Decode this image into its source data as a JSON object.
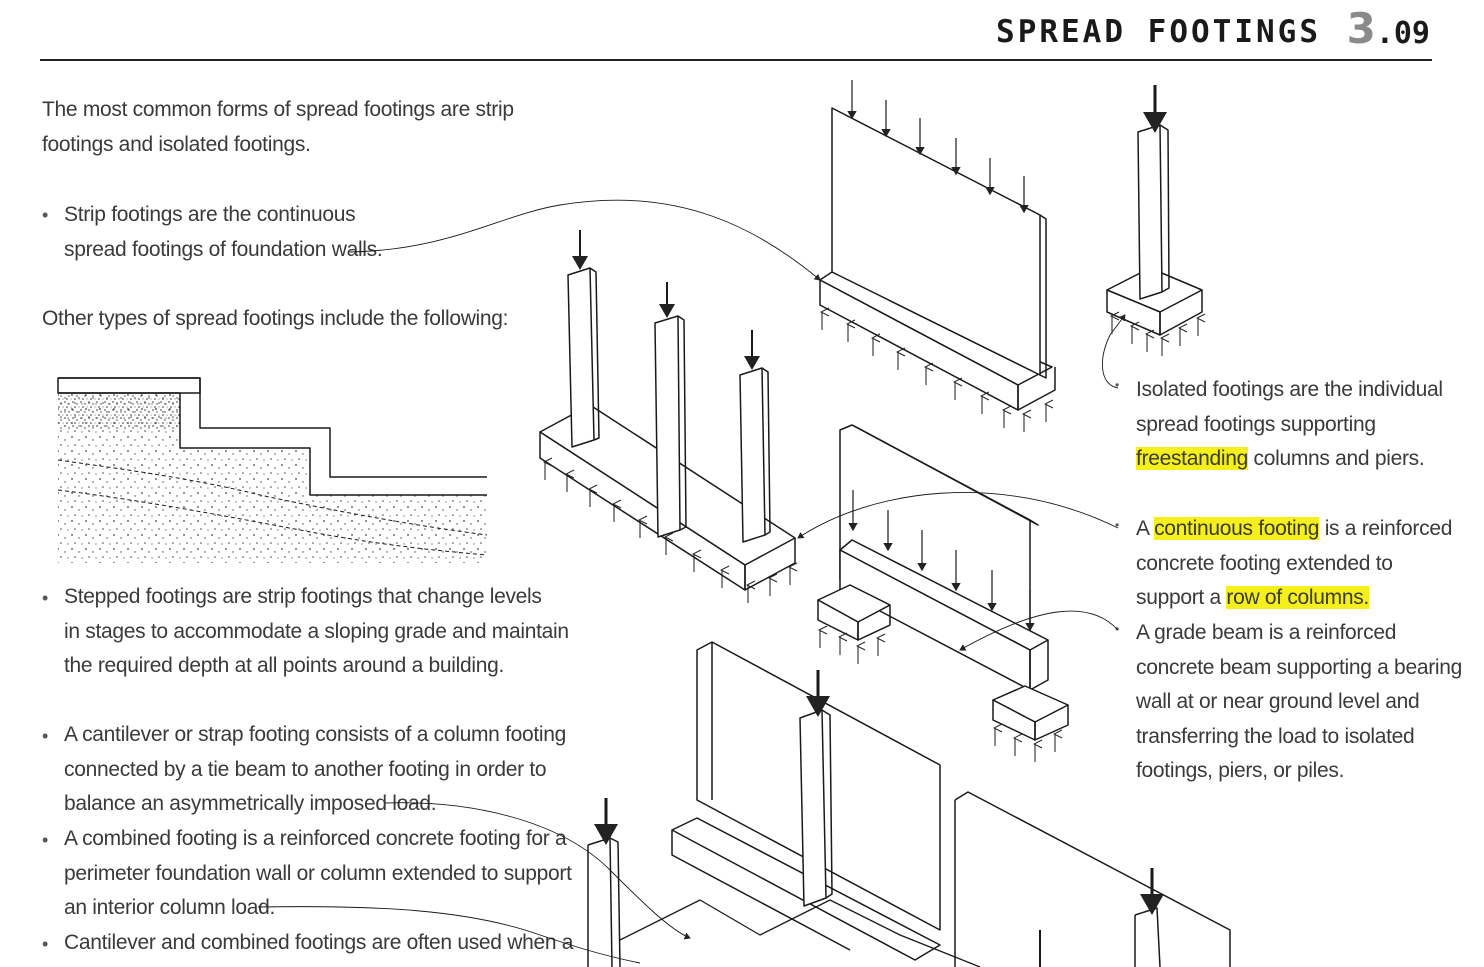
{
  "header": {
    "title": "SPREAD FOOTINGS",
    "section_major": "3",
    "section_minor": ".09"
  },
  "intro": {
    "lines": [
      "The most common forms of spread footings are strip",
      "footings and isolated footings."
    ]
  },
  "strip": {
    "lines": [
      "Strip footings are the continuous",
      "spread footings of foundation walls."
    ]
  },
  "other_types": "Other types of spread footings include the following:",
  "stepped": {
    "lines": [
      "Stepped footings are strip footings that change levels",
      "in stages to accommodate a sloping grade and maintain",
      "the required depth at all points around a building."
    ]
  },
  "cantilever": {
    "lines": [
      "A cantilever or strap footing consists of a column footing",
      "connected by a tie beam to another footing in order to",
      "balance an asymmetrically imposed load."
    ]
  },
  "combined": {
    "lines": [
      "A combined footing is a reinforced concrete footing for a",
      "perimeter foundation wall or column extended to support",
      "an interior column load."
    ]
  },
  "cantilever_combined_cut": "Cantilever and combined footings are often used when a",
  "isolated": {
    "line1": "Isolated footings are the individual",
    "line2": "spread footings supporting",
    "line3_highlight": "freestanding",
    "line3_rest": " columns and piers."
  },
  "continuous": {
    "line1_pre": "A ",
    "line1_highlight": "continuous footing",
    "line1_post": " is a reinforced",
    "line2": "concrete footing extended to",
    "line3_pre": "support a ",
    "line3_highlight": "row of columns."
  },
  "grade_beam": {
    "lines": [
      "A grade beam is a reinforced",
      "concrete beam supporting a bearing",
      "wall at or near ground level and",
      "transferring the load to isolated",
      "footings, piers, or piles."
    ]
  },
  "colors": {
    "highlight": "#f5f019",
    "ink": "#222222"
  }
}
